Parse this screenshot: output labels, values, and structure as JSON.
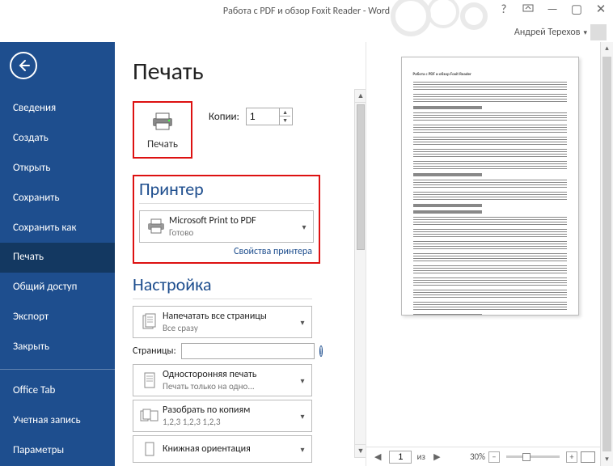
{
  "window": {
    "title": "Работа с PDF и обзор Foxit Reader - Word",
    "user": "Андрей Терехов"
  },
  "sidebar": {
    "items": [
      {
        "label": "Сведения"
      },
      {
        "label": "Создать"
      },
      {
        "label": "Открыть"
      },
      {
        "label": "Сохранить"
      },
      {
        "label": "Сохранить как"
      },
      {
        "label": "Печать"
      },
      {
        "label": "Общий доступ"
      },
      {
        "label": "Экспорт"
      },
      {
        "label": "Закрыть"
      },
      {
        "label": "Office Tab"
      },
      {
        "label": "Учетная запись"
      },
      {
        "label": "Параметры"
      }
    ],
    "active_index": 5
  },
  "print": {
    "heading": "Печать",
    "button_label": "Печать",
    "copies_label": "Копии:",
    "copies_value": "1",
    "printer_section": "Принтер",
    "printer_name": "Microsoft Print to PDF",
    "printer_status": "Готово",
    "printer_props_link": "Свойства принтера",
    "settings_section": "Настройка",
    "print_range": {
      "l1": "Напечатать все страницы",
      "l2": "Все сразу"
    },
    "pages_label": "Страницы:",
    "pages_value": "",
    "onesided": {
      "l1": "Односторонняя печать",
      "l2": "Печать только на одно..."
    },
    "collate": {
      "l1": "Разобрать по копиям",
      "l2": "1,2,3   1,2,3   1,2,3"
    },
    "orientation": {
      "l1": "Книжная ориентация",
      "l2": ""
    }
  },
  "preview": {
    "page_num": "1",
    "page_of_label": "из",
    "zoom_pct": "30%"
  },
  "page_body": {
    "title": "Работа с PDF и обзор Foxit Reader"
  }
}
